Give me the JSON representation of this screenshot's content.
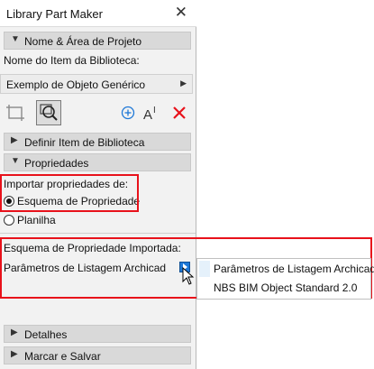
{
  "window": {
    "title": "Library Part Maker",
    "close_glyph": "✕"
  },
  "sections": {
    "name_area": "Nome & Área de Projeto",
    "define_item": "Definir Item de Biblioteca",
    "properties": "Propriedades",
    "details": "Detalhes",
    "mark_save": "Marcar e Salvar"
  },
  "name_area": {
    "label": "Nome do Item da Biblioteca:",
    "selected": "Exemplo de Objeto Genérico"
  },
  "toolbar": {
    "icons": [
      "crop-frame-icon",
      "zoom-fit-icon",
      "add-icon",
      "text-size-icon",
      "delete-icon"
    ],
    "accent_color": "#1e78d7",
    "delete_color": "#e8121b"
  },
  "properties": {
    "import_label": "Importar propriedades de:",
    "options": [
      "Esquema de Propriedade",
      "Planilha"
    ],
    "selected_option": "Esquema de Propriedade",
    "schema_label": "Esquema de Propriedade Importada:",
    "schema_value": "Parâmetros de Listagem Archicad"
  },
  "popup_menu": {
    "items": [
      "Parâmetros de Listagem Archicad",
      "NBS BIM Object Standard 2.0"
    ],
    "checked_item": "Parâmetros de Listagem Archicad"
  },
  "highlight_color": "#e8121b"
}
